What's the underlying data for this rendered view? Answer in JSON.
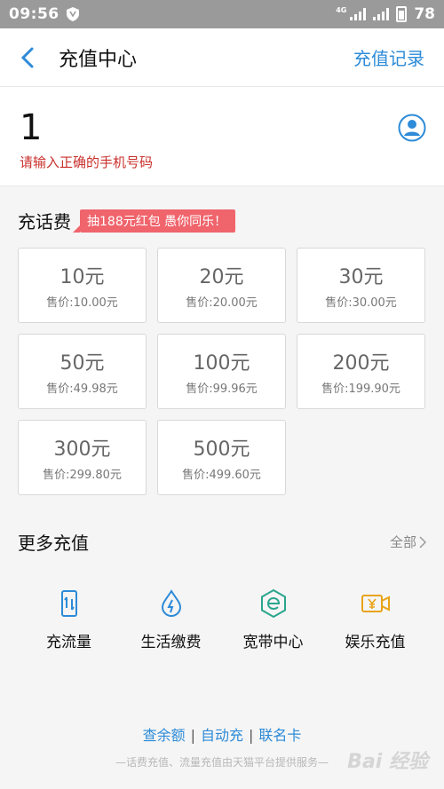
{
  "status_bar": {
    "time": "09:56",
    "network": "4G",
    "battery": "78"
  },
  "nav": {
    "title": "充值中心",
    "right_link": "充值记录"
  },
  "phone": {
    "number": "1",
    "error": "请输入正确的手机号码"
  },
  "charge": {
    "title": "充话费",
    "promo": "抽188元红包 愚你同乐！",
    "options": [
      {
        "amount": "10元",
        "price": "售价:10.00元"
      },
      {
        "amount": "20元",
        "price": "售价:20.00元"
      },
      {
        "amount": "30元",
        "price": "售价:30.00元"
      },
      {
        "amount": "50元",
        "price": "售价:49.98元"
      },
      {
        "amount": "100元",
        "price": "售价:99.96元"
      },
      {
        "amount": "200元",
        "price": "售价:199.90元"
      },
      {
        "amount": "300元",
        "price": "售价:299.80元"
      },
      {
        "amount": "500元",
        "price": "售价:499.60元"
      }
    ]
  },
  "more": {
    "title": "更多充值",
    "all_label": "全部",
    "items": [
      {
        "label": "充流量",
        "icon": "data-flow-icon",
        "color": "#2d8bd8"
      },
      {
        "label": "生活缴费",
        "icon": "water-drop-icon",
        "color": "#2d8bd8"
      },
      {
        "label": "宽带中心",
        "icon": "broadband-icon",
        "color": "#2aa58e"
      },
      {
        "label": "娱乐充值",
        "icon": "video-yen-icon",
        "color": "#e8a317"
      }
    ]
  },
  "footer": {
    "links": [
      "查余额",
      "自动充",
      "联名卡"
    ],
    "note": "—话费充值、流量充值由天猫平台提供服务—",
    "watermark": "Bai 经验"
  }
}
